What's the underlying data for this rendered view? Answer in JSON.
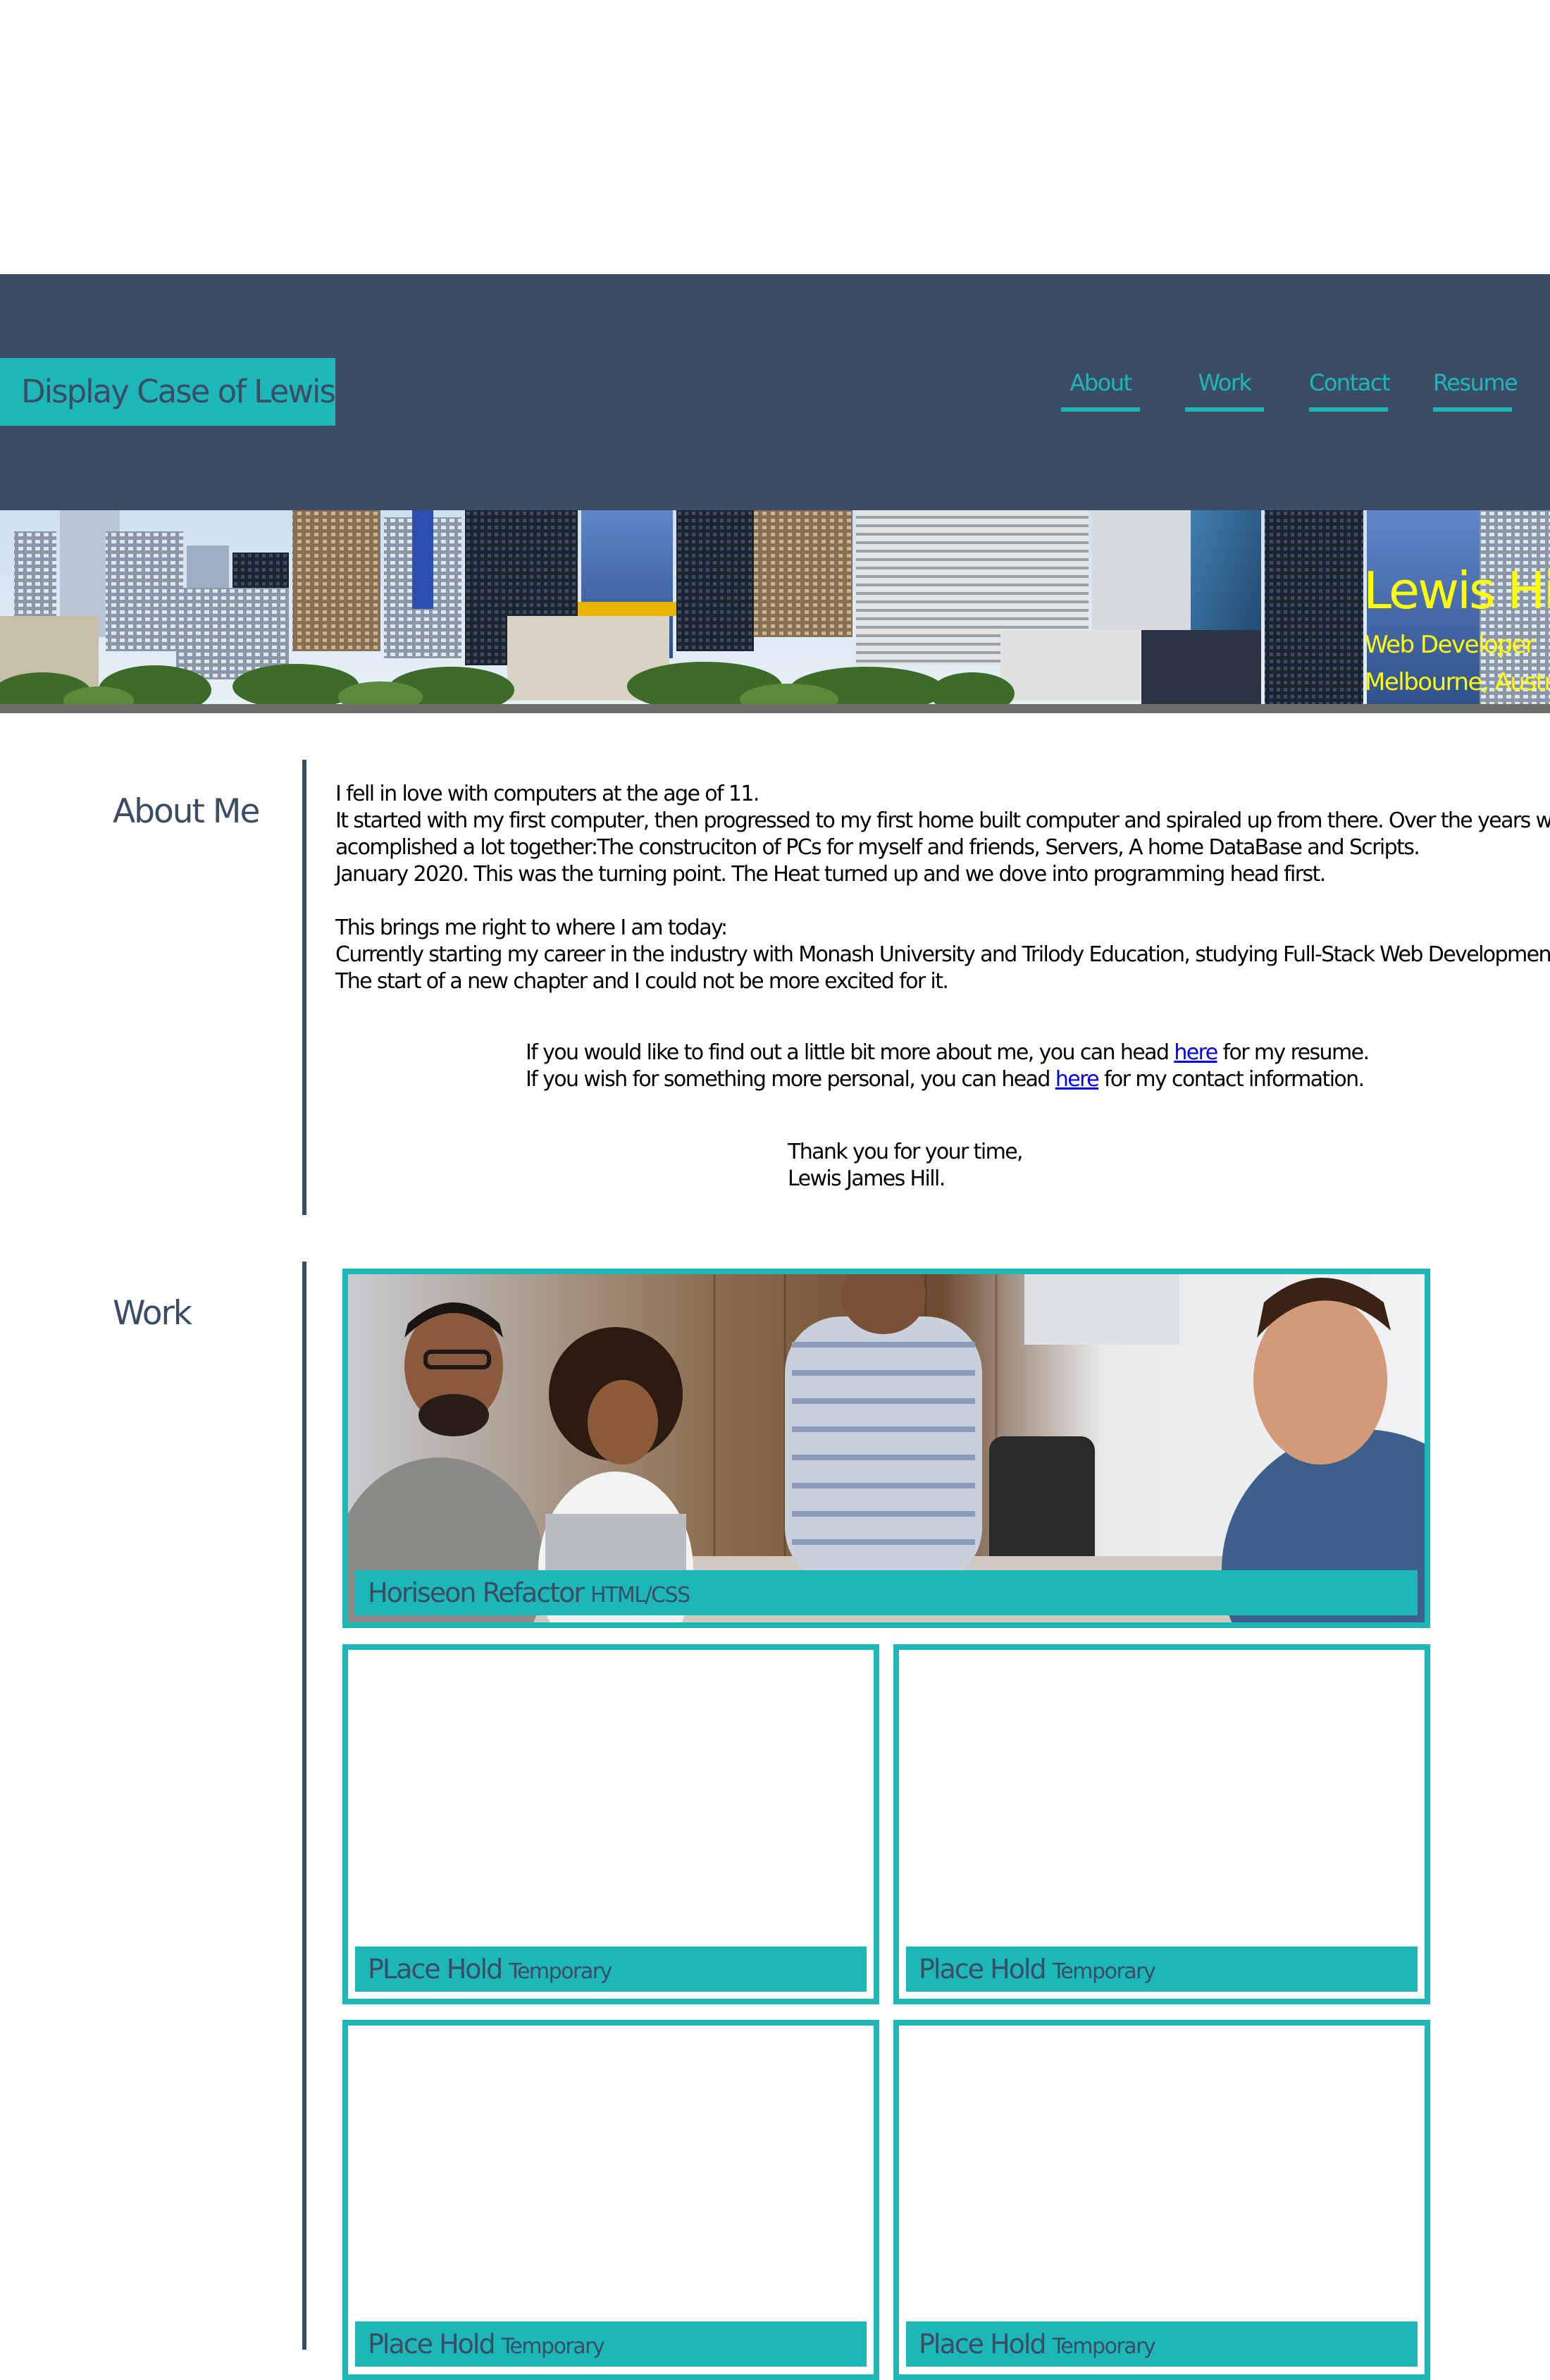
{
  "header": {
    "site_title": "Display Case of Lewis Hill",
    "nav": [
      {
        "label": "About"
      },
      {
        "label": "Work"
      },
      {
        "label": "Contact"
      },
      {
        "label": "Resume"
      }
    ]
  },
  "hero": {
    "name": "Lewis Hill",
    "role": "Web Developer",
    "location": "Melbourne, Australia"
  },
  "about": {
    "heading": "About Me",
    "lines": [
      "I fell in love with computers at the age of 11.",
      "It started with my first computer, then progressed to my first home built computer and spiraled up from there. Over the years we have",
      "acomplished a lot together:The construciton of PCs for myself and friends, Servers, A home DataBase and Scripts.",
      "January 2020. This was the turning point. The Heat turned up and we dove into programming head first."
    ],
    "lines2": [
      "This brings me right to where I am today:",
      "Currently starting my career in the industry with Monash University and Trilody Education, studying Full-Stack Web Development.",
      "The start of a new chapter and I could not be more excited for it."
    ],
    "resume_prefix": "If you would like to find out a little bit more about me, you can head ",
    "resume_link": "here",
    "resume_suffix": " for my resume.",
    "contact_prefix": "If you wish for something more personal, you can head ",
    "contact_link": "here",
    "contact_suffix": " for my contact information.",
    "signoff_1": "Thank you for your time,",
    "signoff_2": "Lewis James Hill."
  },
  "work": {
    "heading": "Work",
    "projects": [
      {
        "title": "Horiseon Refactor",
        "tech": "HTML/CSS"
      },
      {
        "title": "PLace Hold",
        "tech": "Temporary"
      },
      {
        "title": "Place Hold",
        "tech": "Temporary"
      },
      {
        "title": "Place Hold",
        "tech": "Temporary"
      },
      {
        "title": "Place Hold",
        "tech": "Temporary"
      }
    ]
  },
  "colors": {
    "header_bg": "#3b4c66",
    "accent": "#1db7b8",
    "hero_text": "#ffff00",
    "link": "#0000ee"
  }
}
